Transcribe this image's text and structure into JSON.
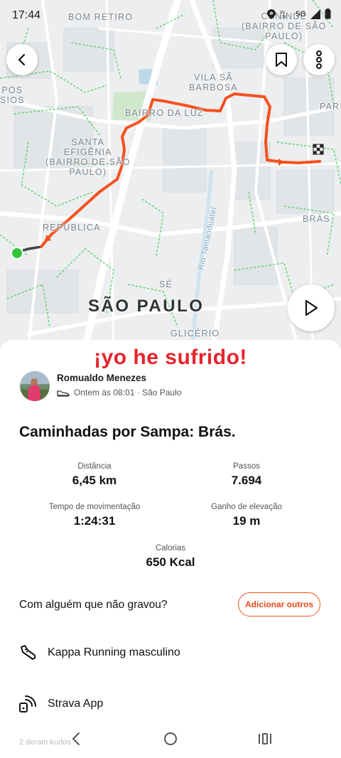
{
  "status_bar": {
    "time": "17:44",
    "network": "5G"
  },
  "map": {
    "labels": [
      {
        "text": "BOM RETIRO",
        "cls": ""
      },
      {
        "text": "CANINDÉ\n(BAIRRO DE SÃO\nPAULO)",
        "cls": ""
      },
      {
        "text": "POS\nSIOS",
        "cls": ""
      },
      {
        "text": "VILA SÃ\nBARBOSA",
        "cls": ""
      },
      {
        "text": "PARI",
        "cls": ""
      },
      {
        "text": "BAIRRO DA LUZ",
        "cls": ""
      },
      {
        "text": "SANTA\nEFIGÊNIA\n(BAIRRO DE SÃO\nPAULO)",
        "cls": ""
      },
      {
        "text": "BRÁS",
        "cls": ""
      },
      {
        "text": "REPÚBLICA",
        "cls": ""
      },
      {
        "text": "SÉ",
        "cls": ""
      },
      {
        "text": "SÃO PAULO",
        "cls": "city"
      },
      {
        "text": "GLICÉRIO",
        "cls": ""
      },
      {
        "text": "Rio Tamanduateí",
        "cls": "river"
      }
    ]
  },
  "overlay_caption": "¡yo he sufrido!",
  "activity": {
    "author": "Romualdo Menezes",
    "meta": "Ontem às 08:01 · São Paulo",
    "title": "Caminhadas por Sampa: Brás.",
    "stats": [
      {
        "label": "Distância",
        "value": "6,45 km"
      },
      {
        "label": "Passos",
        "value": "7.694"
      },
      {
        "label": "Tempo de movimentação",
        "value": "1:24:31"
      },
      {
        "label": "Ganho de elevação",
        "value": "19 m"
      },
      {
        "label": "Calorias",
        "value": "650 Kcal"
      }
    ]
  },
  "with_others": {
    "question": "Com alguém que não gravou?",
    "button": "Adicionar outros"
  },
  "gear": {
    "label": "Kappa Running masculino"
  },
  "device": {
    "label": "Strava App"
  },
  "kudos": "2 deram kudos",
  "colors": {
    "route": "#f4511e",
    "accent": "#fc4c02",
    "start": "#34c43a",
    "trails": "#2ecc40"
  }
}
